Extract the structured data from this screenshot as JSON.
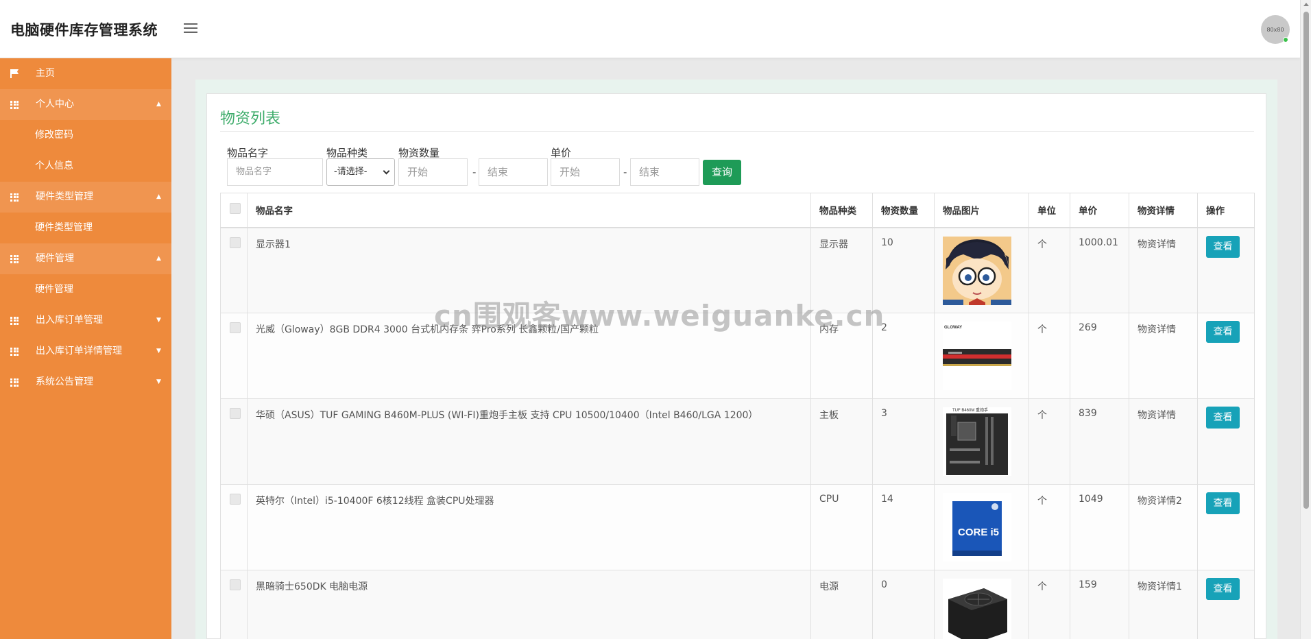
{
  "app": {
    "title": "电脑硬件库存管理系统",
    "avatar_text": "80x80"
  },
  "sidebar": {
    "items": [
      {
        "label": "主页"
      },
      {
        "label": "个人中心",
        "children": [
          "修改密码",
          "个人信息"
        ]
      },
      {
        "label": "硬件类型管理",
        "children": [
          "硬件类型管理"
        ]
      },
      {
        "label": "硬件管理",
        "children": [
          "硬件管理"
        ]
      },
      {
        "label": "出入库订单管理"
      },
      {
        "label": "出入库订单详情管理"
      },
      {
        "label": "系统公告管理"
      }
    ]
  },
  "page": {
    "title": "物资列表"
  },
  "filters": {
    "name_label": "物品名字",
    "name_placeholder": "物品名字",
    "type_label": "物品种类",
    "type_selected": "-请选择-",
    "qty_label": "物资数量",
    "qty_start": "开始",
    "qty_end": "结束",
    "price_label": "单价",
    "price_start": "开始",
    "price_end": "结束",
    "dash": "-",
    "query_button": "查询"
  },
  "table": {
    "headers": [
      "物品名字",
      "物品种类",
      "物资数量",
      "物品图片",
      "单位",
      "单价",
      "物资详情",
      "操作"
    ],
    "rows": [
      {
        "name": "显示器1",
        "type": "显示器",
        "qty": "10",
        "image": "anime-character-portrait",
        "unit": "个",
        "price": "1000.01",
        "detail": "物资详情",
        "action": "查看"
      },
      {
        "name": "光威（Gloway）8GB DDR4 3000 台式机内存条 弈Pro系列 长鑫颗粒/国产颗粒",
        "type": "内存",
        "qty": "2",
        "image": "ram-module",
        "unit": "个",
        "price": "269",
        "detail": "物资详情",
        "action": "查看"
      },
      {
        "name": "华硕（ASUS）TUF GAMING B460M-PLUS (WI-FI)重炮手主板 支持 CPU 10500/10400（Intel B460/LGA 1200）",
        "type": "主板",
        "qty": "3",
        "image": "motherboard",
        "unit": "个",
        "price": "839",
        "detail": "物资详情",
        "action": "查看"
      },
      {
        "name": "英特尔（Intel）i5-10400F 6核12线程 盒装CPU处理器",
        "type": "CPU",
        "qty": "14",
        "image": "cpu-box",
        "unit": "个",
        "price": "1049",
        "detail": "物资详情2",
        "action": "查看"
      },
      {
        "name": "黑暗骑士650DK 电脑电源",
        "type": "电源",
        "qty": "0",
        "image": "power-supply",
        "unit": "个",
        "price": "159",
        "detail": "物资详情1",
        "action": "查看"
      }
    ]
  },
  "ram_logo_text": "GLOWAY",
  "mb_logo_text": "TUF B460M 重炮手",
  "cpu_box_text": "CORE i5",
  "watermark": "cn围观客www.weiguanke.cn",
  "colors": {
    "sidebar": "#ee8a3c",
    "title": "#3eac6b",
    "query": "#1e9b57",
    "view": "#17a2b8"
  }
}
